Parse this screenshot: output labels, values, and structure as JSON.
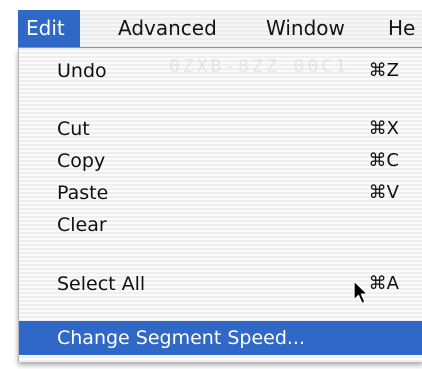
{
  "menubar": {
    "items": [
      {
        "label": "Edit",
        "active": true
      },
      {
        "label": "Advanced",
        "active": false
      },
      {
        "label": "Window",
        "active": false
      },
      {
        "label": "He",
        "active": false
      }
    ]
  },
  "edit_menu": {
    "items": [
      {
        "label": "Undo",
        "shortcut": "⌘Z"
      },
      {
        "label": "Cut",
        "shortcut": "⌘X"
      },
      {
        "label": "Copy",
        "shortcut": "⌘C"
      },
      {
        "label": "Paste",
        "shortcut": "⌘V"
      },
      {
        "label": "Clear",
        "shortcut": ""
      },
      {
        "label": "Select All",
        "shortcut": "⌘A"
      },
      {
        "label": "Change Segment Speed...",
        "shortcut": "",
        "highlighted": true
      }
    ]
  },
  "cursor": {
    "icon": "arrow-pointer-icon"
  },
  "colors": {
    "highlight": "#2f68c6",
    "menu_text": "#111111",
    "highlight_text": "#ffffff"
  }
}
